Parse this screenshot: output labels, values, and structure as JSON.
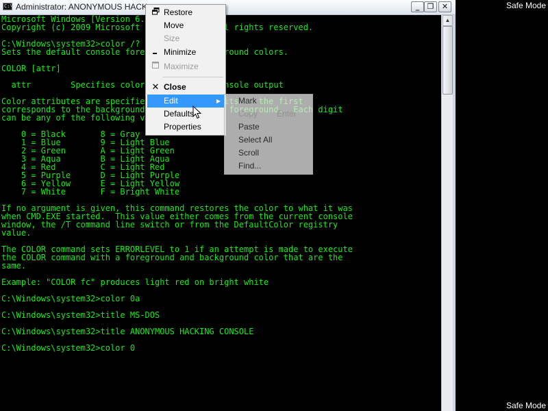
{
  "window": {
    "title": "Administrator:  ANONYMOUS HACK",
    "title_icon": "cmd-icon",
    "buttons": {
      "minimize": "minimize-icon",
      "maximize": "maximize-icon",
      "close": "close-icon"
    }
  },
  "console": {
    "text_color": "#18ea18",
    "lines": [
      "Microsoft Windows [Version 6.1.7600]",
      "Copyright (c) 2009 Microsoft Corporation.  All rights reserved.",
      "",
      "C:\\Windows\\system32>color /?",
      "Sets the default console foreground and background colors.",
      "",
      "COLOR [attr]",
      "",
      "  attr        Specifies color attribute of console output",
      "",
      "Color attributes are specified by TWO hex digits -- the first",
      "corresponds to the background; the second the foreground.  Each digit",
      "can be any of the following values:",
      "",
      "    0 = Black       8 = Gray",
      "    1 = Blue        9 = Light Blue",
      "    2 = Green       A = Light Green",
      "    3 = Aqua        B = Light Aqua",
      "    4 = Red         C = Light Red",
      "    5 = Purple      D = Light Purple",
      "    6 = Yellow      E = Light Yellow",
      "    7 = White       F = Bright White",
      "",
      "If no argument is given, this command restores the color to what it was",
      "when CMD.EXE started.  This value either comes from the current console",
      "window, the /T command line switch or from the DefaultColor registry",
      "value.",
      "",
      "The COLOR command sets ERRORLEVEL to 1 if an attempt is made to execute",
      "the COLOR command with a foreground and background color that are the",
      "same.",
      "",
      "Example: \"COLOR fc\" produces light red on bright white",
      "",
      "C:\\Windows\\system32>color 0a",
      "",
      "C:\\Windows\\system32>title MS-DOS",
      "",
      "C:\\Windows\\system32>title ANONYMOUS HACKING CONSOLE",
      "",
      "C:\\Windows\\system32>color 0"
    ]
  },
  "overlay": {
    "safe_mode_top": "Safe Mode",
    "safe_mode_bottom": "Safe Mode"
  },
  "system_menu": {
    "items": [
      {
        "label": "Restore",
        "icon": "restore-icon"
      },
      {
        "label": "Move"
      },
      {
        "label": "Size",
        "disabled": true
      },
      {
        "label": "Minimize",
        "icon": "minimize-icon"
      },
      {
        "label": "Maximize",
        "icon": "maximize-icon",
        "disabled": true
      },
      {
        "label": "Close",
        "icon": "close-icon"
      },
      {
        "label": "Edit",
        "selected": true,
        "submenu": true
      },
      {
        "label": "Defaults"
      },
      {
        "label": "Properties"
      }
    ],
    "highlight_color": "#3399ff"
  },
  "edit_submenu": {
    "items": [
      {
        "label": "Mark"
      },
      {
        "label": "Copy",
        "shortcut": "Enter",
        "disabled": true
      },
      {
        "label": "Paste"
      },
      {
        "label": "Select All"
      },
      {
        "label": "Scroll"
      },
      {
        "label": "Find..."
      }
    ]
  }
}
